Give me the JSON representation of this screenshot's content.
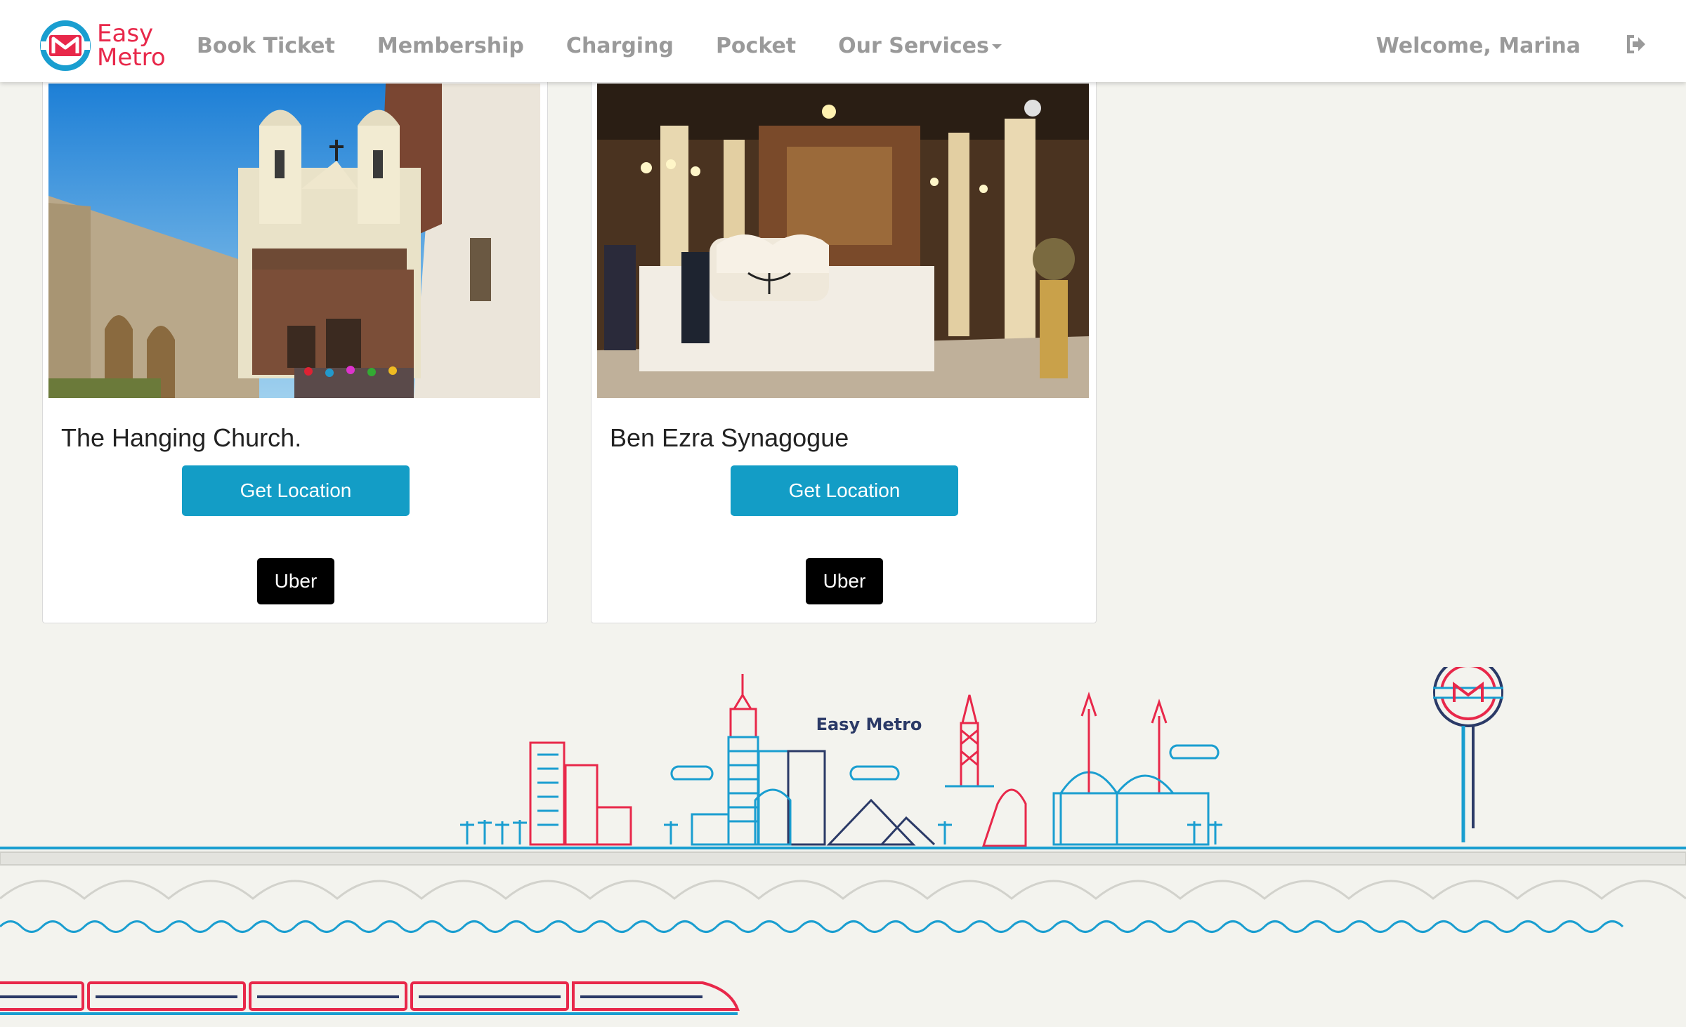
{
  "brand": {
    "line1": "Easy",
    "line2": "Metro",
    "logo_icon": "metro-logo-icon"
  },
  "nav": {
    "items": [
      {
        "label": "Book Ticket"
      },
      {
        "label": "Membership"
      },
      {
        "label": "Charging"
      },
      {
        "label": "Pocket"
      },
      {
        "label": "Our Services"
      }
    ],
    "welcome": "Welcome, Marina",
    "logout_icon": "sign-out-icon"
  },
  "cards": [
    {
      "title": "The Hanging Church.",
      "location_label": "Get Location",
      "uber_label": "Uber"
    },
    {
      "title": "Ben Ezra Synagogue",
      "location_label": "Get Location",
      "uber_label": "Uber"
    }
  ],
  "footer": {
    "skyline_label": "Easy Metro"
  },
  "colors": {
    "accent": "#139dc6",
    "brand_red": "#e8284a",
    "navy": "#2b3a67",
    "background": "#f3f3ee"
  }
}
